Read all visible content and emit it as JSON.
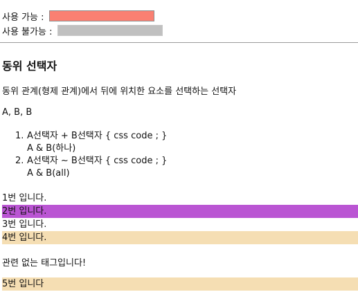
{
  "form": {
    "enabled_label": "사용 가능 : ",
    "disabled_label": "사용 불가능 : ",
    "enabled_bg": "#fa8072",
    "disabled_bg": "#c0c0c0"
  },
  "heading": "동위 선택자",
  "description": "동위 관계(형제 관계)에서 뒤에 위치한 요소를 선택하는 선택자",
  "abc_line": "A, B, B",
  "rules": [
    {
      "number": "1.",
      "line1": "A선택자 + B선택자 { css code ; }",
      "line2": "A & B(하나)"
    },
    {
      "number": "2.",
      "line1": "A선택자 ~ B선택자 { css code ; }",
      "line2": "A & B(all)"
    }
  ],
  "items": {
    "item1": {
      "text": "1번 입니다.",
      "bg": "transparent"
    },
    "item2": {
      "text": "2번 입니다.",
      "bg": "#ba55d3"
    },
    "item3": {
      "text": "3번 입니다.",
      "bg": "transparent"
    },
    "item4": {
      "text": "4번 입니다.",
      "bg": "#f5deb3"
    },
    "unrelated": {
      "text": "관련 없는 태그입니다!"
    },
    "item5": {
      "text": "5번 입니다",
      "bg": "#f5deb3"
    }
  }
}
